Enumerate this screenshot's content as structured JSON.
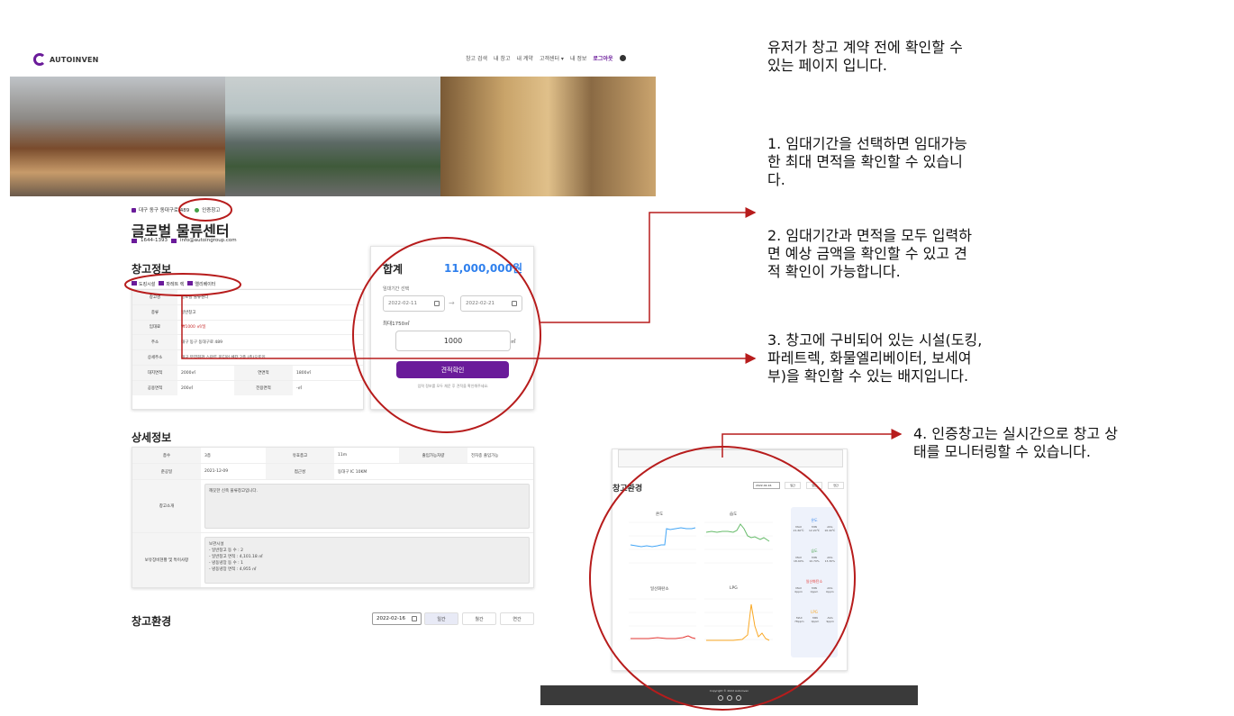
{
  "nav": {
    "logo": "AUTOINVEN",
    "items": [
      "창고 검색",
      "내 창고",
      "내 계약",
      "고객센터 ▾",
      "내 정보"
    ],
    "logout": "로그아웃"
  },
  "header": {
    "address": "대구 동구 동대구로 489",
    "certified": "인증창고",
    "title": "글로벌 물류센터",
    "phone": "1644-1393",
    "email": "info@autoingroup.com"
  },
  "info": {
    "heading": "창고정보",
    "badges": [
      "도킹시설",
      "파레트 렉",
      "엘리베이터"
    ],
    "rows": [
      {
        "k": "창고명",
        "v": "글로벌 물류센터"
      },
      {
        "k": "종류",
        "v": "일반창고"
      },
      {
        "k": "임대료",
        "v": "₩1000 ㎡/일"
      },
      {
        "k": "주소",
        "v": "대구 동구 동대구로 489"
      },
      {
        "k": "상세주소",
        "v": "대구 무역회관 스마트 미디어 센터 2층 (주)오토인"
      }
    ],
    "area_row": {
      "k1": "대지면적",
      "v1": "2000㎡",
      "k2": "연면적",
      "v2": "1800㎡"
    },
    "share_row": {
      "k1": "공용면적",
      "v1": "200㎡",
      "k2": "전용면적",
      "v2": "-㎡"
    }
  },
  "quote": {
    "total_label": "합계",
    "total_value": "11,000,000원",
    "period_label": "임대기간 선택",
    "start_date": "2022-02-11",
    "end_date": "2022-02-21",
    "max_label": "최대1750㎡",
    "area_value": "1000",
    "unit": "㎡",
    "button": "견적확인",
    "hint": "입력 정보를 모두 채운 후 견적을 확인해주세요."
  },
  "detail": {
    "heading": "상세정보",
    "r1": {
      "k1": "층수",
      "v1": "3층",
      "k2": "유효층고",
      "v2": "11m",
      "k3": "출입가능차량",
      "v3": "전차종 출입가능"
    },
    "r2": {
      "k1": "준공일",
      "v1": "2021-12-09",
      "k2": "접근성",
      "v2": "동대구 IC 10KM"
    },
    "intro_k": "창고소개",
    "intro_v": "깨끗한 신축 물류창고입니다.",
    "facility_k": "보유장비현황 및 특이사항",
    "facility_v": "보관시설\n - 일반창고 동 수 : 2\n - 일반창고 면적 : 4,101.18 ㎡\n - 냉동냉장 동 수 : 1\n - 냉동냉장 면적 : 4,955 ㎡"
  },
  "env": {
    "heading": "창고환경",
    "date": "2022-02-16",
    "tabs": [
      "일간",
      "월간",
      "연간"
    ]
  },
  "monitor": {
    "title": "창고환경",
    "date": "2022-02-16",
    "tabs": [
      "일간",
      "월간",
      "연간"
    ],
    "charts": [
      "온도",
      "습도",
      "일산화탄소",
      "LPG"
    ],
    "side": [
      {
        "name": "온도",
        "color": "#2f80ed",
        "labels": [
          "MAX",
          "MIN",
          "AVG"
        ],
        "values": [
          "21.60℃",
          "12.20℃",
          "16.40℃"
        ]
      },
      {
        "name": "습도",
        "color": "#43a047",
        "labels": [
          "MAX",
          "MIN",
          "AVG"
        ],
        "values": [
          "18.40%",
          "10.70%",
          "13.30%"
        ]
      },
      {
        "name": "일산화탄소",
        "color": "#e53935",
        "labels": [
          "MAX",
          "MIN",
          "AVG"
        ],
        "values": [
          "0ppm",
          "0ppm",
          "0ppm"
        ]
      },
      {
        "name": "LPG",
        "color": "#f9a825",
        "labels": [
          "MAX",
          "MIN",
          "AVG"
        ],
        "values": [
          "78ppm",
          "0ppm",
          "9ppm"
        ]
      }
    ]
  },
  "footer": {
    "copyright": "Copyright © 2022 Autoinven"
  },
  "notes": {
    "intro": "유저가 창고 계약 전에 확인할 수\n있는 페이지 입니다.",
    "n1": "1. 임대기간을 선택하면 임대가능\n한 최대 면적을 확인할 수 있습니\n다.",
    "n2": "2. 임대기간과 면적을 모두 입력하\n면 예상 금액을 확인할 수 있고 견\n적 확인이 가능합니다.",
    "n3": "3. 창고에 구비되어 있는 시설(도킹,\n파레트렉, 화물엘리베이터, 보세여\n부)을 확인할 수 있는 배지입니다.",
    "n4": "4. 인증창고는 실시간으로 창고 상\n태를 모니터링할 수 있습니다."
  },
  "colors": {
    "accent": "#6a1b9a",
    "annotation": "#b71c1c",
    "price": "#2f80ed"
  }
}
